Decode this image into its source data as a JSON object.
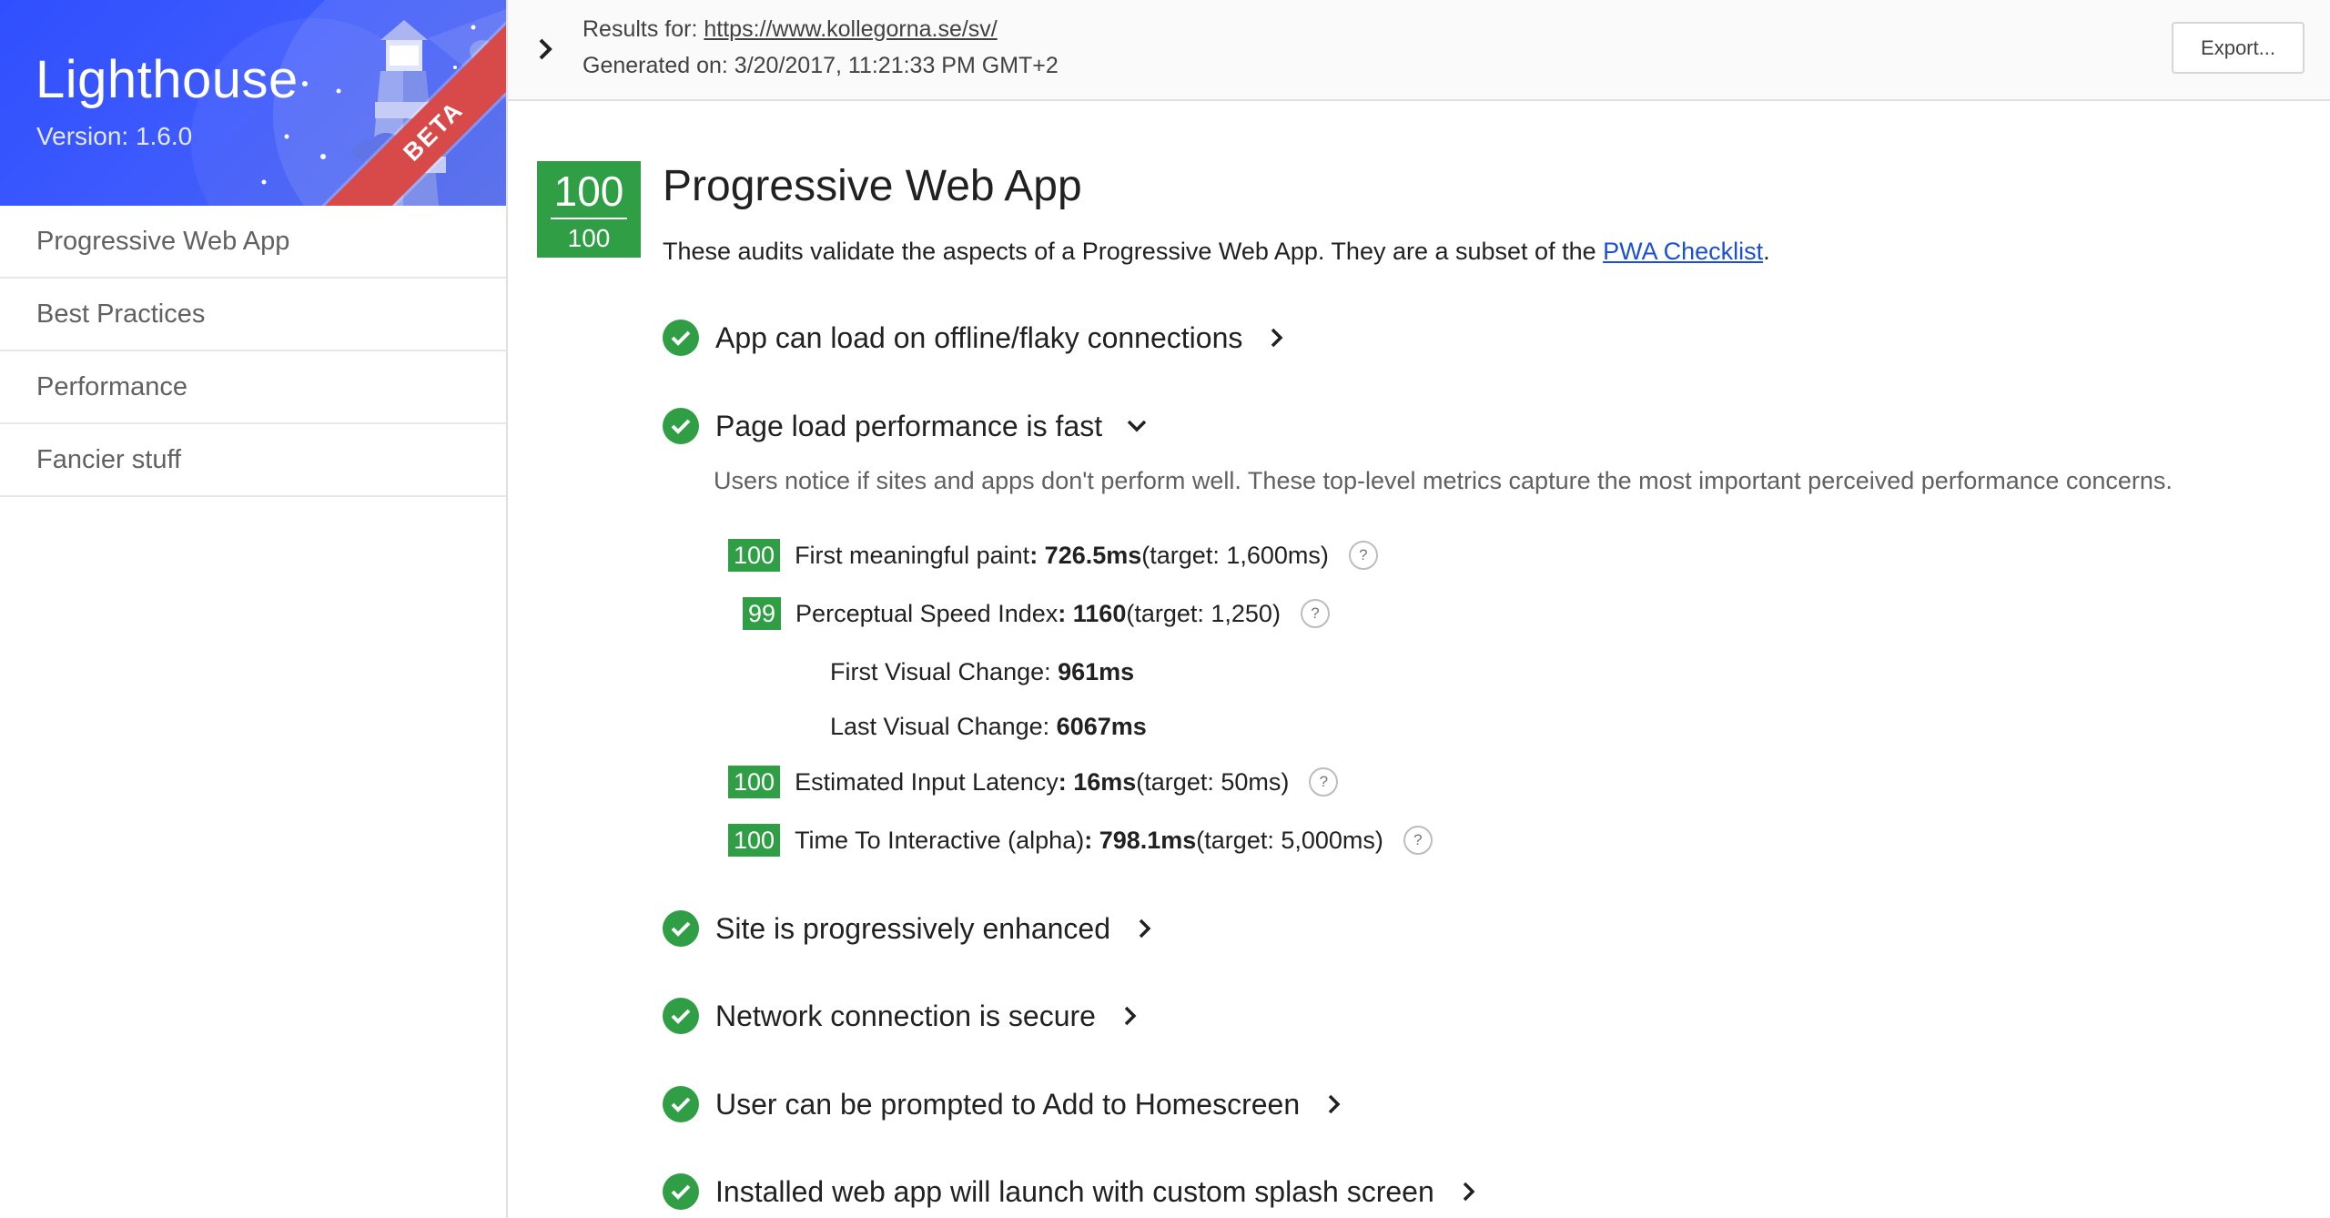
{
  "sidebar": {
    "title": "Lighthouse",
    "version": "Version: 1.6.0",
    "beta": "BETA",
    "items": [
      {
        "label": "Progressive Web App"
      },
      {
        "label": "Best Practices"
      },
      {
        "label": "Performance"
      },
      {
        "label": "Fancier stuff"
      }
    ]
  },
  "header": {
    "results_label": "Results for: ",
    "results_url": "https://www.kollegorna.se/sv/",
    "generated": "Generated on: 3/20/2017, 11:21:33 PM GMT+2",
    "export_label": "Export..."
  },
  "category": {
    "score": "100",
    "score_small": "100",
    "title": "Progressive Web App",
    "desc_prefix": "These audits validate the aspects of a Progressive Web App. They are a subset of the ",
    "desc_link": "PWA Checklist",
    "desc_suffix": "."
  },
  "audits": [
    {
      "title": "App can load on offline/flaky connections",
      "expanded": false
    },
    {
      "title": "Page load performance is fast",
      "expanded": true,
      "description": "Users notice if sites and apps don't perform well. These top-level metrics capture the most important perceived performance concerns."
    },
    {
      "title": "Site is progressively enhanced",
      "expanded": false
    },
    {
      "title": "Network connection is secure",
      "expanded": false
    },
    {
      "title": "User can be prompted to Add to Homescreen",
      "expanded": false
    },
    {
      "title": "Installed web app will launch with custom splash screen",
      "expanded": false
    }
  ],
  "metrics": [
    {
      "score": "100",
      "name": "First meaningful paint",
      "value": ": 726.5ms",
      "target": " (target: 1,600ms)"
    },
    {
      "score": "99",
      "name": "Perceptual Speed Index",
      "value": ": 1160",
      "target": " (target: 1,250)"
    },
    {
      "score": "100",
      "name": "Estimated Input Latency",
      "value": ": 16ms",
      "target": " (target: 50ms)"
    },
    {
      "score": "100",
      "name": "Time To Interactive (alpha)",
      "value": ": 798.1ms",
      "target": " (target: 5,000ms)"
    }
  ],
  "sub_metrics": [
    {
      "name": "First Visual Change: ",
      "value": "961ms"
    },
    {
      "name": "Last Visual Change: ",
      "value": "6067ms"
    }
  ],
  "help_glyph": "?",
  "colors": {
    "pass": "#2f9e45",
    "brand": "#304ffe",
    "beta": "#d84949",
    "link": "#1a4fd6"
  },
  "icons": {
    "check": "check-icon",
    "chevron": "chevron-right-icon",
    "expanded": "chevron-down-icon"
  }
}
